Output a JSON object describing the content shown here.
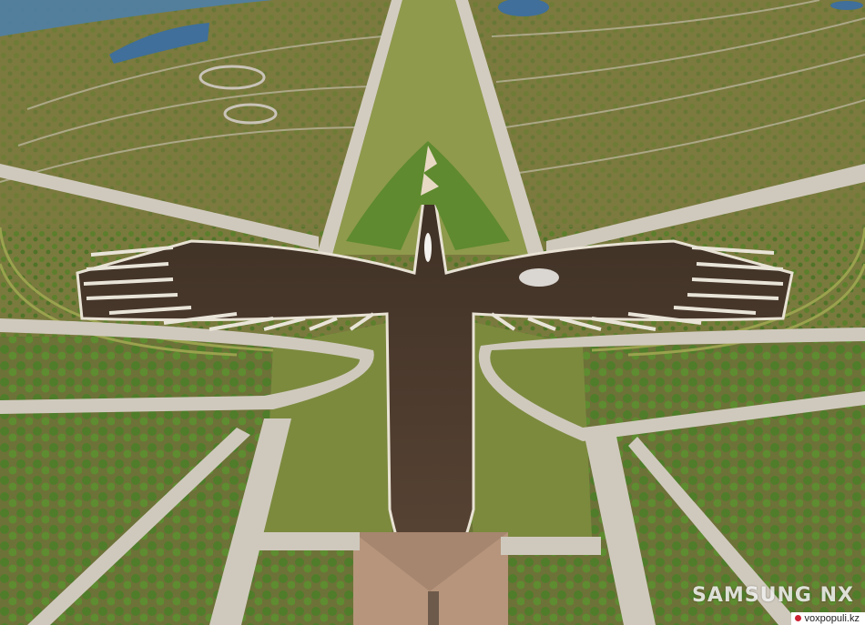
{
  "photo": {
    "watermark": "SAMSUNG NX",
    "credit": "voxpopuli.kz"
  },
  "colors": {
    "grass": "#79813f",
    "grass_light": "#8f9a4c",
    "path": "#c9c3b8",
    "water": "#4a3a2c",
    "pond": "#3f6f9a",
    "trees": "#5f8a2f"
  }
}
